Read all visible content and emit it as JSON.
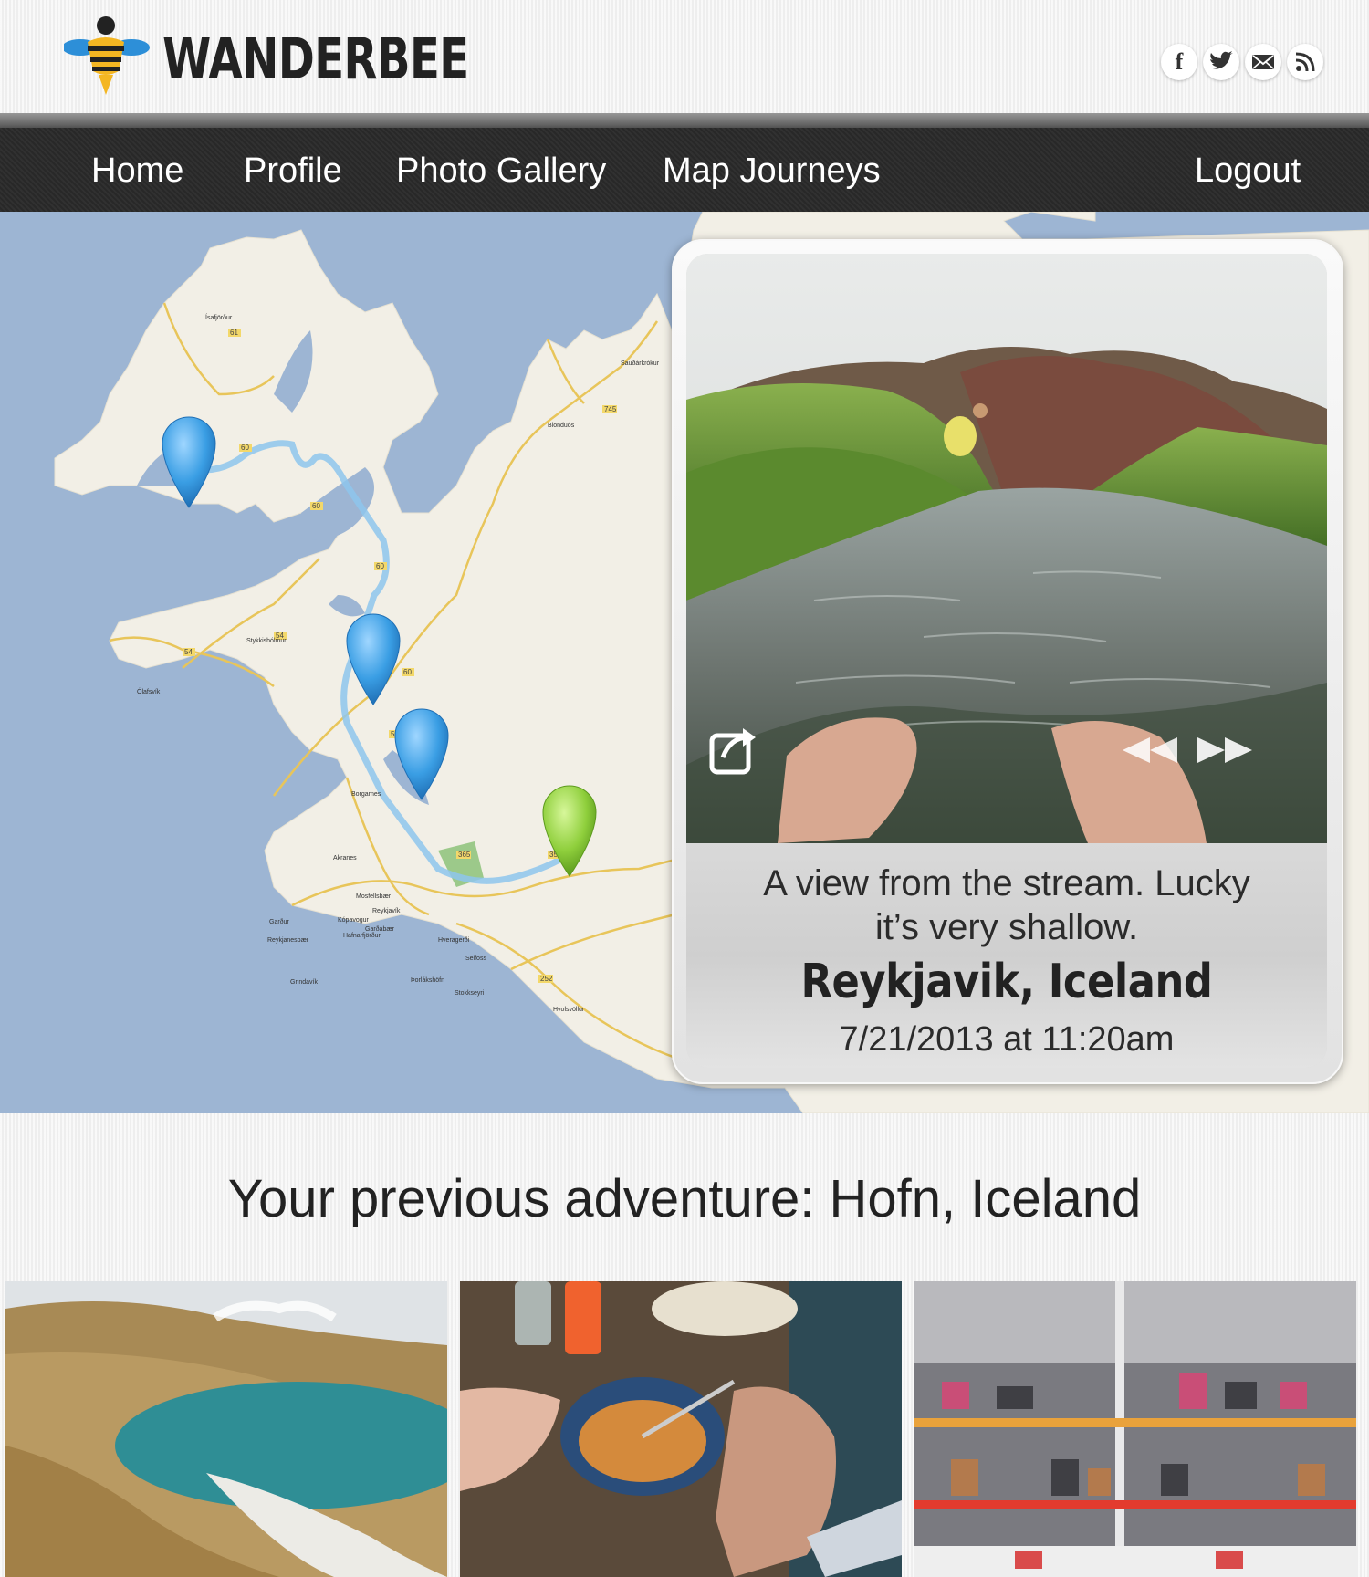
{
  "brand": {
    "name": "WANDERBEE"
  },
  "social": [
    {
      "icon": "facebook-icon",
      "glyph": "f"
    },
    {
      "icon": "twitter-icon",
      "glyph": ""
    },
    {
      "icon": "email-icon",
      "glyph": ""
    },
    {
      "icon": "rss-icon",
      "glyph": ""
    }
  ],
  "nav": {
    "home": "Home",
    "profile": "Profile",
    "photo_gallery": "Photo Gallery",
    "map_journeys": "Map Journeys",
    "logout": "Logout"
  },
  "map": {
    "pins": [
      {
        "name": "pin-west-fjords",
        "color": "#3a9ee4"
      },
      {
        "name": "pin-snaefellsnes",
        "color": "#3a9ee4"
      },
      {
        "name": "pin-borgarnes",
        "color": "#3a9ee4"
      },
      {
        "name": "pin-current-location",
        "color": "#8fcf3c"
      }
    ],
    "towns": [
      "Ísafjörður",
      "Blönduós",
      "Sauðárkrókur",
      "Stykkishólmur",
      "Ólafsvík",
      "Borgarnes",
      "Akranes",
      "Mosfellsbær",
      "Reykjavík",
      "Kópavogur",
      "Garðabær",
      "Hafnarfjörður",
      "Garður",
      "Reykjanesbær",
      "Grindavík",
      "Hveragerði",
      "Selfoss",
      "Þorlákshöfn",
      "Stokkseyri",
      "Hvolsvöllur"
    ]
  },
  "popup": {
    "description": "A view from the stream. Lucky it’s very shallow.",
    "location": "Reykjavik, Iceland",
    "datetime": "7/21/2013 at 11:20am"
  },
  "previous": {
    "title": "Your previous adventure: Hofn, Iceland",
    "thumbnails": [
      "crater-lake-photo",
      "soup-bowl-photo",
      "shoe-store-photo"
    ]
  }
}
